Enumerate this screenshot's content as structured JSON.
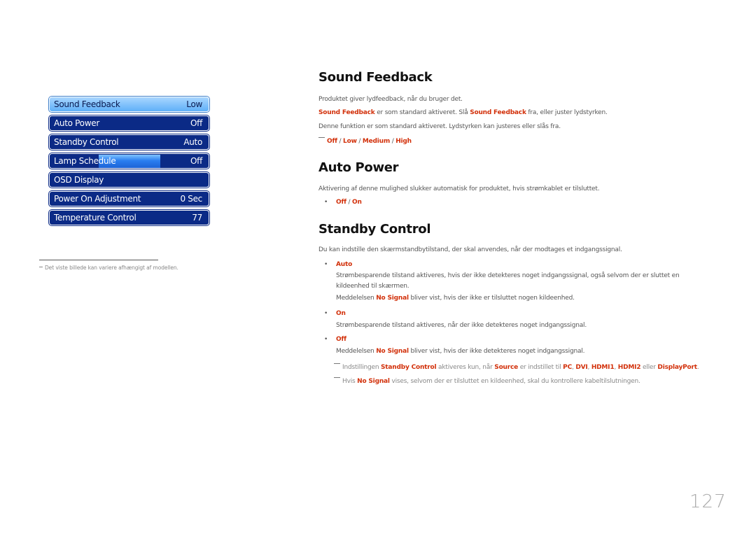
{
  "osd_menu": {
    "items": [
      {
        "label": "Sound Feedback",
        "value": "Low"
      },
      {
        "label": "Auto Power",
        "value": "Off"
      },
      {
        "label": "Standby Control",
        "value": "Auto"
      },
      {
        "label": "Lamp Schedule",
        "value": "Off"
      },
      {
        "label": "OSD Display",
        "value": ""
      },
      {
        "label": "Power On Adjustment",
        "value": "0 Sec"
      },
      {
        "label": "Temperature Control",
        "value": "77"
      }
    ]
  },
  "footnote": "Det viste billede kan variere afhængigt af modellen.",
  "sound_feedback": {
    "title": "Sound Feedback",
    "p1": "Produktet giver lydfeedback, når du bruger det.",
    "p2": {
      "a": "Sound Feedback",
      "b": " er som standard aktiveret. Slå ",
      "c": "Sound Feedback",
      "d": " fra, eller juster lydstyrken."
    },
    "p3": "Denne funktion er som standard aktiveret. Lydstyrken kan justeres eller slås fra.",
    "options": [
      "Off",
      "Low",
      "Medium",
      "High"
    ],
    "sep": " / "
  },
  "auto_power": {
    "title": "Auto Power",
    "p1": "Aktivering af denne mulighed slukker automatisk for produktet, hvis strømkablet er tilsluttet.",
    "options": [
      "Off",
      "On"
    ],
    "sep": " / "
  },
  "standby_control": {
    "title": "Standby Control",
    "p1": "Du kan indstille den skærmstandbytilstand, der skal anvendes, når der modtages et indgangssignal.",
    "auto": {
      "label": "Auto",
      "line1": "Strømbesparende tilstand aktiveres, hvis der ikke detekteres noget indgangssignal, også selvom der er sluttet en",
      "line2": "kildeenhed til skærmen.",
      "line3a": "Meddelelsen ",
      "line3b": "No Signal",
      "line3c": " bliver vist, hvis der ikke er tilsluttet nogen kildeenhed."
    },
    "on": {
      "label": "On",
      "line1": "Strømbesparende tilstand aktiveres, når der ikke detekteres noget indgangssignal."
    },
    "off": {
      "label": "Off",
      "line1a": "Meddelelsen ",
      "line1b": "No Signal",
      "line1c": " bliver vist, hvis der ikke detekteres noget indgangssignal."
    },
    "note1": {
      "a": "Indstillingen ",
      "b": "Standby Control",
      "c": " aktiveres kun, når ",
      "d": "Source",
      "e": " er indstillet til ",
      "f": "PC",
      "g": ", ",
      "h": "DVI",
      "i": ", ",
      "j": "HDMI1",
      "k": ", ",
      "l": "HDMI2",
      "m": " eller ",
      "n": "DisplayPort",
      "o": "."
    },
    "note2": {
      "a": "Hvis ",
      "b": "No Signal",
      "c": " vises, selvom der er tilsluttet en kildeenhed, skal du kontrollere kabeltilslutningen."
    }
  },
  "page_number": "127",
  "bullet_char": "•"
}
